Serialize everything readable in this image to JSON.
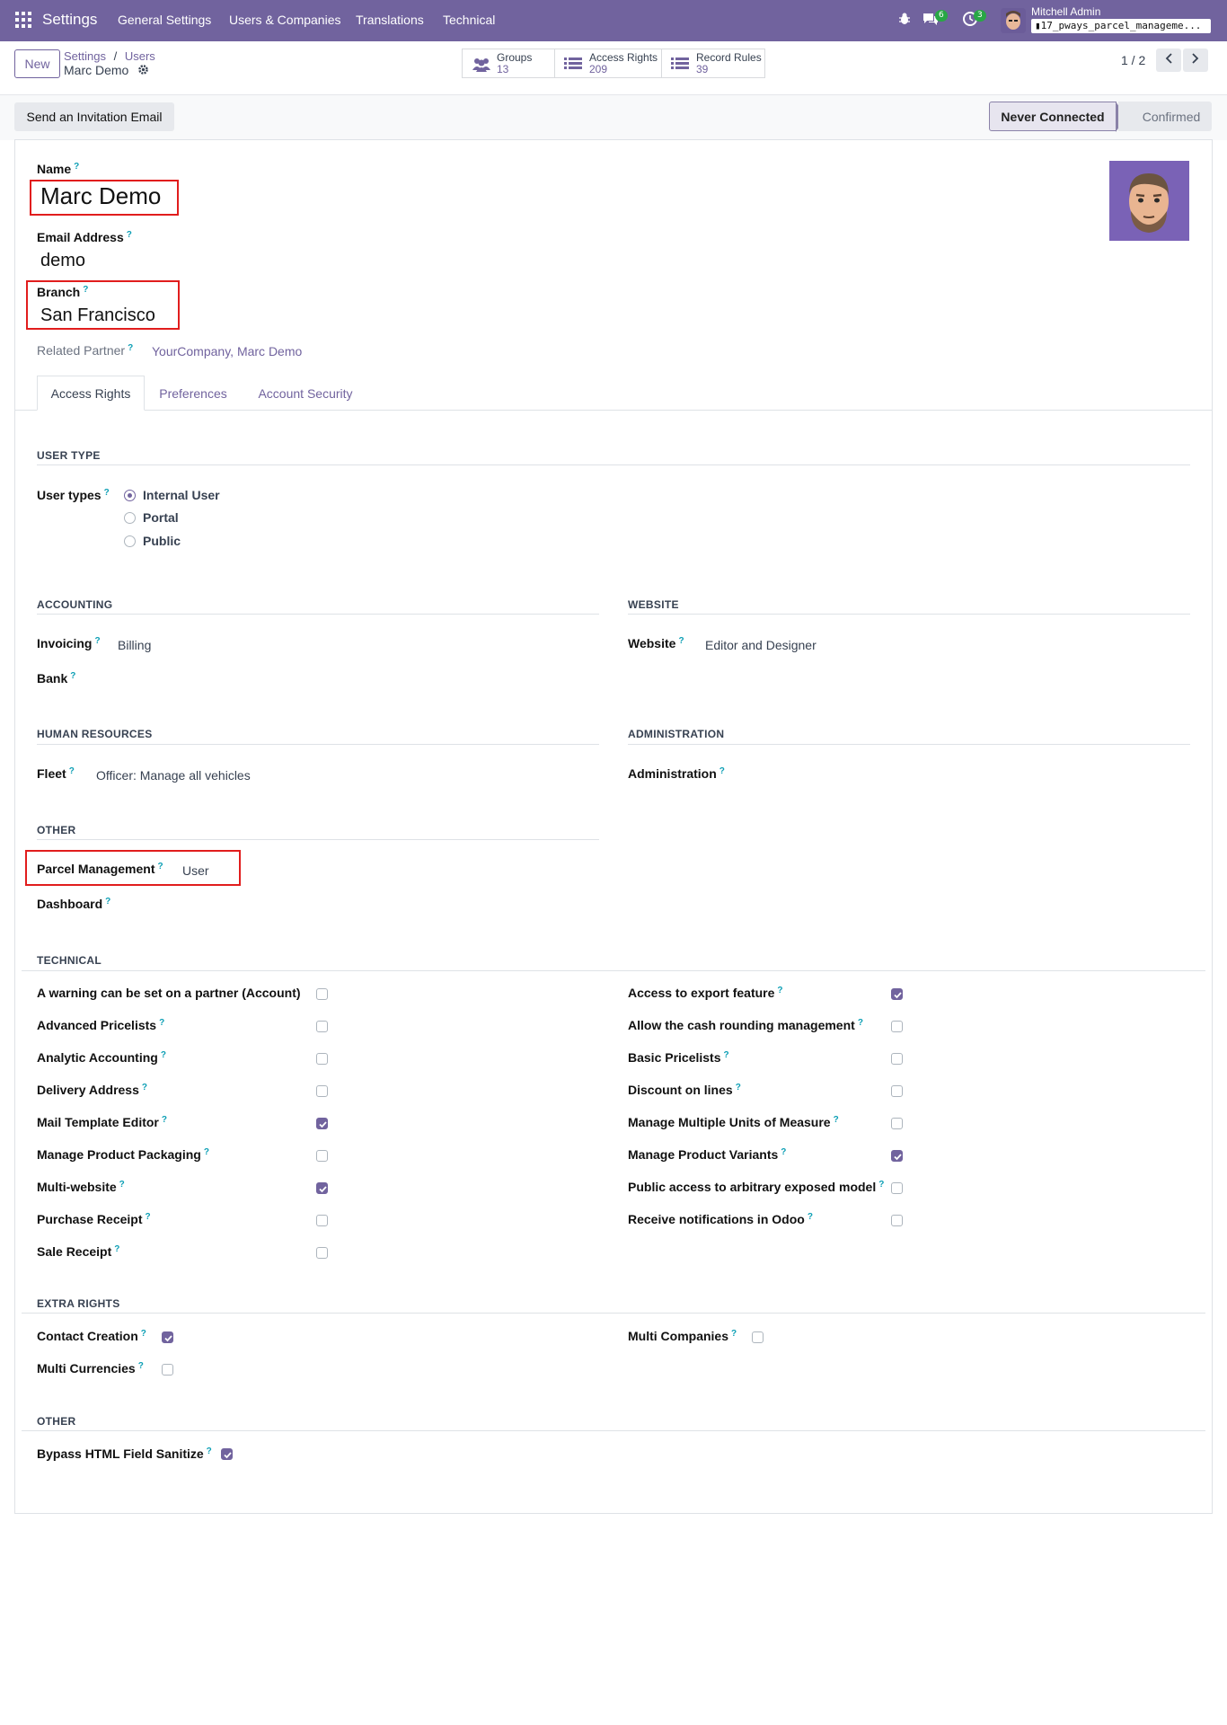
{
  "navbar": {
    "app_title": "Settings",
    "menus": [
      "General Settings",
      "Users & Companies",
      "Translations",
      "Technical"
    ],
    "messages_count": "6",
    "activities_count": "3",
    "user_name": "Mitchell Admin",
    "database": "17_pways_parcel_manageme..."
  },
  "control_panel": {
    "new_label": "New",
    "breadcrumb_settings": "Settings",
    "breadcrumb_sep": "/",
    "breadcrumb_users": "Users",
    "record_title": "Marc Demo",
    "stats": [
      {
        "label": "Groups",
        "value": "13"
      },
      {
        "label": "Access Rights",
        "value": "209"
      },
      {
        "label": "Record Rules",
        "value": "39"
      }
    ],
    "pager": "1 / 2"
  },
  "status": {
    "invite_label": "Send an Invitation Email",
    "stage_current": "Never Connected",
    "stage_next": "Confirmed"
  },
  "form": {
    "name_label": "Name",
    "name_value": "Marc Demo",
    "email_label": "Email Address",
    "email_value": "demo",
    "branch_label": "Branch",
    "branch_value": "San Francisco",
    "partner_label": "Related Partner",
    "partner_value": "YourCompany, Marc Demo",
    "tabs": [
      "Access Rights",
      "Preferences",
      "Account Security"
    ]
  },
  "access": {
    "user_type_section": "USER TYPE",
    "user_types_label": "User types",
    "user_types": [
      "Internal User",
      "Portal",
      "Public"
    ],
    "accounting_section": "ACCOUNTING",
    "invoicing_label": "Invoicing",
    "invoicing_value": "Billing",
    "bank_label": "Bank",
    "website_section": "WEBSITE",
    "website_label": "Website",
    "website_value": "Editor and Designer",
    "hr_section": "HUMAN RESOURCES",
    "fleet_label": "Fleet",
    "fleet_value": "Officer: Manage all vehicles",
    "admin_section": "ADMINISTRATION",
    "admin_label": "Administration",
    "other_section": "OTHER",
    "parcel_label": "Parcel Management",
    "parcel_value": "User",
    "dashboard_label": "Dashboard",
    "technical_section": "TECHNICAL",
    "technical_left": [
      {
        "label": "A warning can be set on a partner (Account)",
        "checked": false
      },
      {
        "label": "Advanced Pricelists",
        "checked": false
      },
      {
        "label": "Analytic Accounting",
        "checked": false
      },
      {
        "label": "Delivery Address",
        "checked": false
      },
      {
        "label": "Mail Template Editor",
        "checked": true
      },
      {
        "label": "Manage Product Packaging",
        "checked": false
      },
      {
        "label": "Multi-website",
        "checked": true
      },
      {
        "label": "Purchase Receipt",
        "checked": false
      },
      {
        "label": "Sale Receipt",
        "checked": false
      }
    ],
    "technical_right": [
      {
        "label": "Access to export feature",
        "checked": true
      },
      {
        "label": "Allow the cash rounding management",
        "checked": false
      },
      {
        "label": "Basic Pricelists",
        "checked": false
      },
      {
        "label": "Discount on lines",
        "checked": false
      },
      {
        "label": "Manage Multiple Units of Measure",
        "checked": false
      },
      {
        "label": "Manage Product Variants",
        "checked": true
      },
      {
        "label": "Public access to arbitrary exposed model",
        "checked": false
      },
      {
        "label": "Receive notifications in Odoo",
        "checked": false
      }
    ],
    "extra_section": "EXTRA RIGHTS",
    "extra": [
      {
        "label": "Contact Creation",
        "checked": true
      },
      {
        "label": "Multi Currencies",
        "checked": false
      },
      {
        "label": "Multi Companies",
        "checked": false
      }
    ],
    "other2_section": "OTHER",
    "bypass_label": "Bypass HTML Field Sanitize",
    "bypass_checked": true
  },
  "colors": {
    "brand": "#71639e",
    "highlight": "#e11d1d"
  }
}
